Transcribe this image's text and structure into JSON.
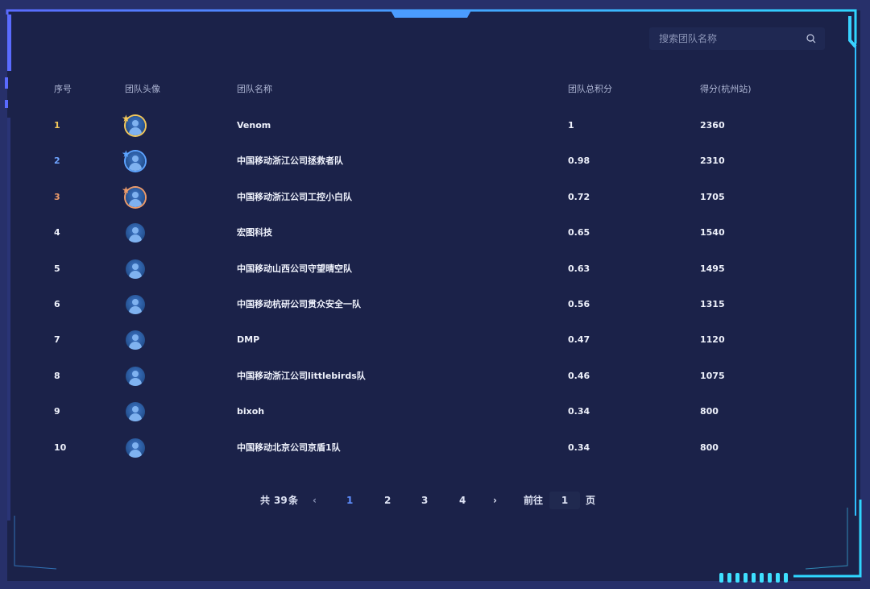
{
  "search": {
    "placeholder": "搜索团队名称"
  },
  "table": {
    "headers": [
      "序号",
      "团队头像",
      "团队名称",
      "团队总积分",
      "得分(杭州站)"
    ],
    "rows": [
      {
        "rank": "1",
        "name": "Venom",
        "total": "1",
        "score": "2360",
        "badge": "gold-crown-icon",
        "badge_color": "#f3c85a"
      },
      {
        "rank": "2",
        "name": "中国移动浙江公司拯救者队",
        "total": "0.98",
        "score": "2310",
        "badge": "blue-crown-icon",
        "badge_color": "#5ca3ff"
      },
      {
        "rank": "3",
        "name": "中国移动浙江公司工控小白队",
        "total": "0.72",
        "score": "1705",
        "badge": "orange-crown-icon",
        "badge_color": "#ec9b6a"
      },
      {
        "rank": "4",
        "name": "宏图科技",
        "total": "0.65",
        "score": "1540"
      },
      {
        "rank": "5",
        "name": "中国移动山西公司守望晴空队",
        "total": "0.63",
        "score": "1495"
      },
      {
        "rank": "6",
        "name": "中国移动杭研公司贯众安全一队",
        "total": "0.56",
        "score": "1315"
      },
      {
        "rank": "7",
        "name": "DMP",
        "total": "0.47",
        "score": "1120"
      },
      {
        "rank": "8",
        "name": "中国移动浙江公司littlebirds队",
        "total": "0.46",
        "score": "1075"
      },
      {
        "rank": "9",
        "name": "bixoh",
        "total": "0.34",
        "score": "800"
      },
      {
        "rank": "10",
        "name": "中国移动北京公司京盾1队",
        "total": "0.34",
        "score": "800"
      }
    ]
  },
  "pagination": {
    "total_prefix": "共",
    "total": "39",
    "total_suffix": "条",
    "prev": "‹",
    "pages": [
      "1",
      "2",
      "3",
      "4"
    ],
    "current": "1",
    "next": "›",
    "goto_label": "前往",
    "goto_value": "1",
    "goto_suffix": "页"
  },
  "colors": {
    "background": "#1a2147",
    "accent": "#5f8fff",
    "frame": "#3ea6ff"
  }
}
